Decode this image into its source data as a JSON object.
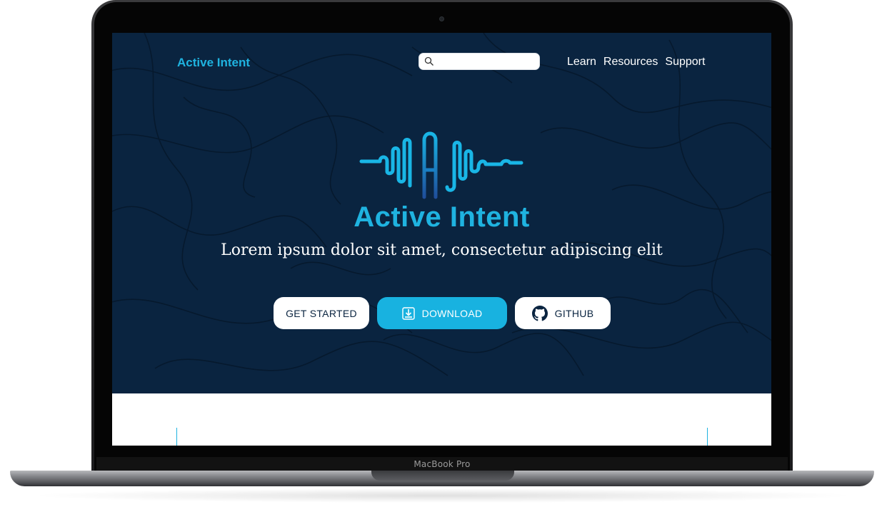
{
  "device": {
    "label": "MacBook Pro"
  },
  "nav": {
    "logo": "Active Intent",
    "search": {
      "placeholder": "",
      "value": ""
    },
    "links": [
      "Learn",
      "Resources",
      "Support"
    ]
  },
  "hero": {
    "title": "Active Intent",
    "subtitle": "Lorem ipsum dolor sit amet, consectetur adipiscing elit",
    "buttons": {
      "get_started": "GET STARTED",
      "download": "DOWNLOAD",
      "github": "GITHUB"
    }
  },
  "colors": {
    "hero_bg": "#0a2440",
    "accent": "#1fb3e0",
    "button_white": "#ffffff"
  },
  "icons": {
    "search": "search-icon",
    "download": "download-icon",
    "github": "github-icon",
    "logo": "soundwave-ai-logo"
  }
}
